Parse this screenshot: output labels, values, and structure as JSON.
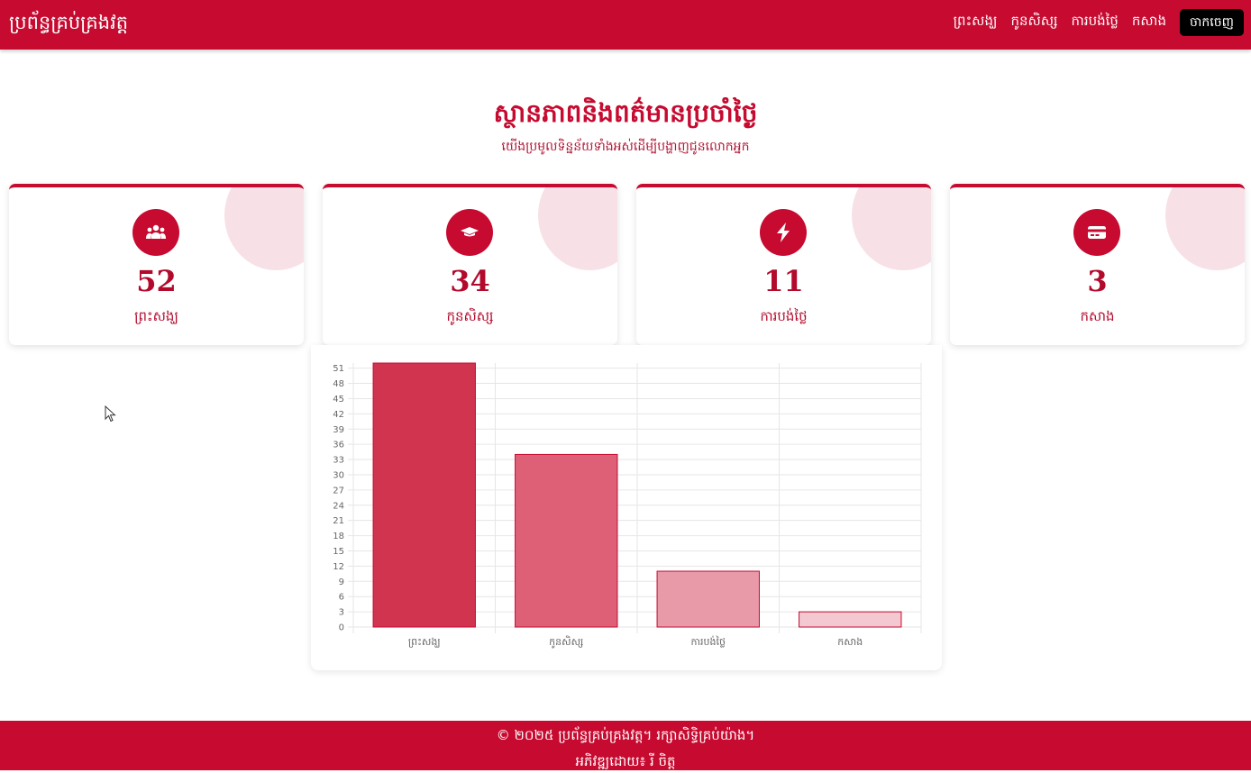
{
  "nav": {
    "brand": "ប្រព័ន្ធគ្រប់គ្រងវត្ត",
    "links": [
      "ព្រះសង្ឃ",
      "កូនសិស្ស",
      "ការបង់ថ្លៃ",
      "កសាង"
    ],
    "logout_label": "ចាកចេញ"
  },
  "hero": {
    "title": "ស្ថានភាពនិងពត៌មានប្រចាំថ្ងៃ",
    "subtitle": "យើងប្រមូលទិន្នន័យទាំងអស់ដើម្បីបង្ហាញជូនលោកអ្នក"
  },
  "stats": [
    {
      "count": "52",
      "label": "ព្រះសង្ឃ",
      "icon": "users-icon"
    },
    {
      "count": "34",
      "label": "កូនសិស្ស",
      "icon": "graduation-cap-icon"
    },
    {
      "count": "11",
      "label": "ការបង់ថ្លៃ",
      "icon": "bolt-icon"
    },
    {
      "count": "3",
      "label": "កសាង",
      "icon": "credit-card-icon"
    }
  ],
  "chart_data": {
    "type": "bar",
    "categories": [
      "ព្រះសង្ឃ",
      "កូនសិស្ស",
      "ការបង់ថ្លៃ",
      "កសាង"
    ],
    "values": [
      52,
      34,
      11,
      3
    ],
    "ylim": [
      0,
      52
    ],
    "yticks": [
      0,
      3,
      6,
      9,
      12,
      15,
      18,
      21,
      24,
      27,
      30,
      33,
      36,
      39,
      42,
      45,
      48,
      51
    ],
    "grid": true,
    "bar_colors": [
      "#d0344f",
      "#dd6076",
      "#e89aa8",
      "#f3c8d1"
    ],
    "border_color": "#c60a30"
  },
  "footer": {
    "copyright": "© ២០២៥ ប្រព័ន្ធគ្រប់គ្រងវត្ត។ រក្សាសិទ្ធិគ្រប់យ៉ាង។",
    "credit": "អភិវឌ្ឍដោយ៖ រី ចិត្ត"
  },
  "colors": {
    "primary": "#c60a30",
    "bubble": "#f7e1e6"
  }
}
